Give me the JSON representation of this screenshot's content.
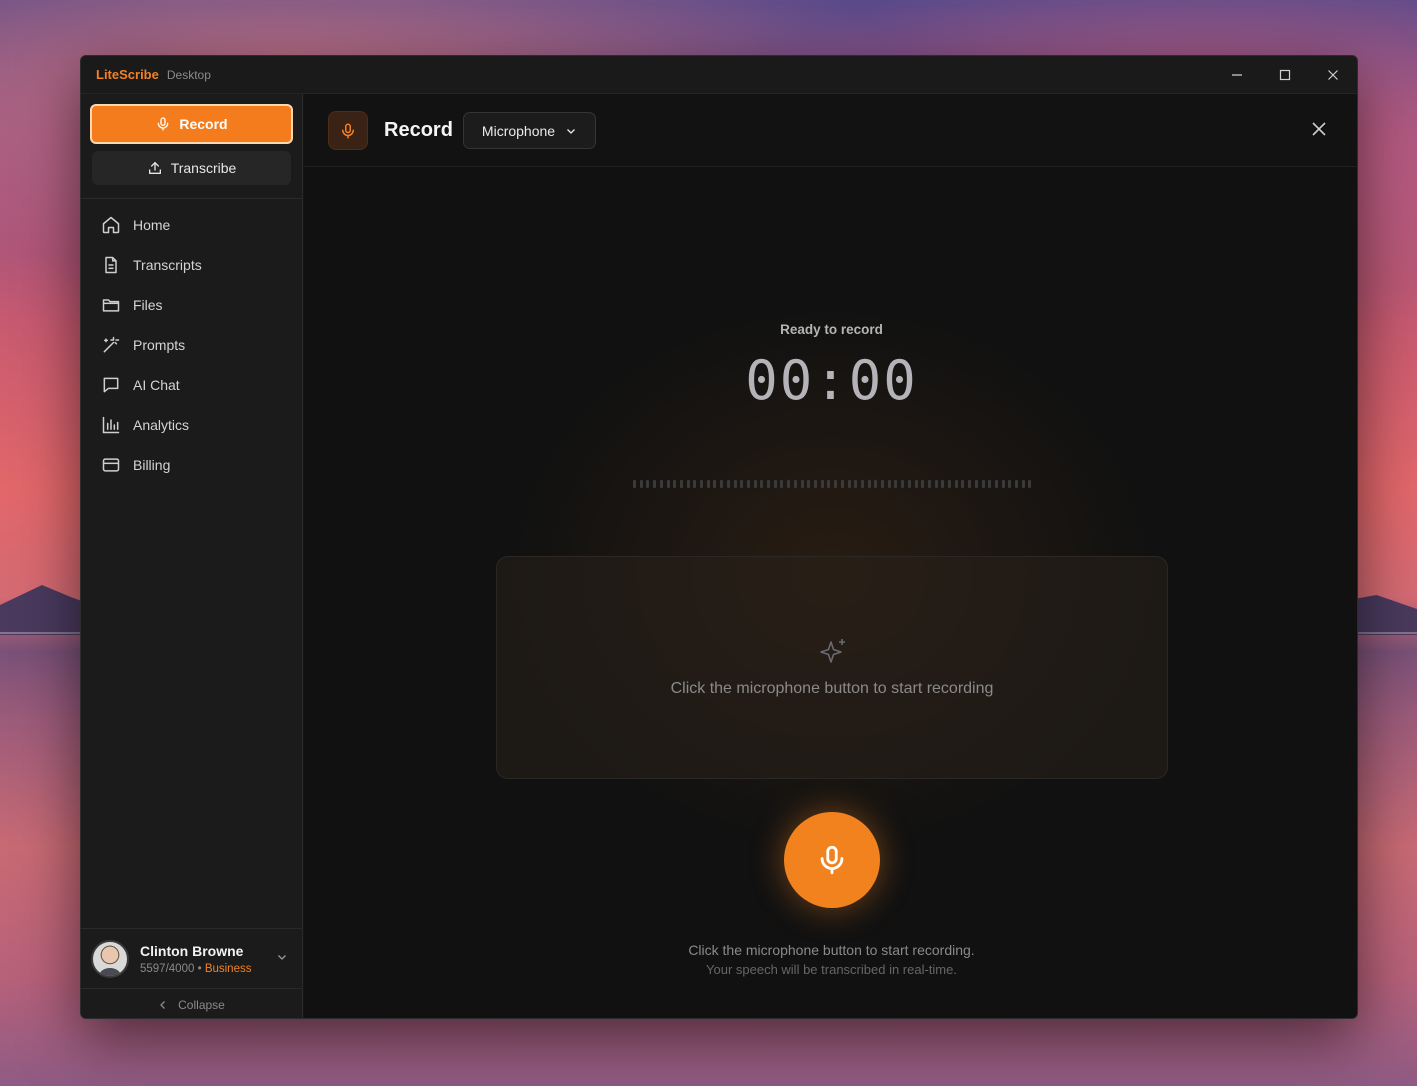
{
  "app": {
    "name": "LiteScribe",
    "subtitle": "Desktop"
  },
  "window_controls": {
    "minimize": "minimize-icon",
    "maximize": "maximize-icon",
    "close": "close-icon"
  },
  "sidebar": {
    "record_label": "Record",
    "transcribe_label": "Transcribe",
    "items": [
      {
        "label": "Home",
        "icon": "home-icon"
      },
      {
        "label": "Transcripts",
        "icon": "document-icon"
      },
      {
        "label": "Files",
        "icon": "folder-icon"
      },
      {
        "label": "Prompts",
        "icon": "magic-wand-icon"
      },
      {
        "label": "AI Chat",
        "icon": "chat-icon"
      },
      {
        "label": "Analytics",
        "icon": "bar-chart-icon"
      },
      {
        "label": "Billing",
        "icon": "credit-card-icon"
      }
    ],
    "user": {
      "name": "Clinton Browne",
      "usage": "5597/4000",
      "separator": "•",
      "plan": "Business"
    },
    "collapse_label": "Collapse"
  },
  "main": {
    "title": "Record",
    "source": "Microphone",
    "status": "Ready to record",
    "timer": "00:00",
    "panel_text": "Click the microphone button to start recording",
    "hint_line1": "Click the microphone button to start recording.",
    "hint_line2": "Your speech will be transcribed in real-time."
  },
  "colors": {
    "accent": "#f47c1c",
    "background": "#111111",
    "sidebar": "#1b1b1b"
  }
}
